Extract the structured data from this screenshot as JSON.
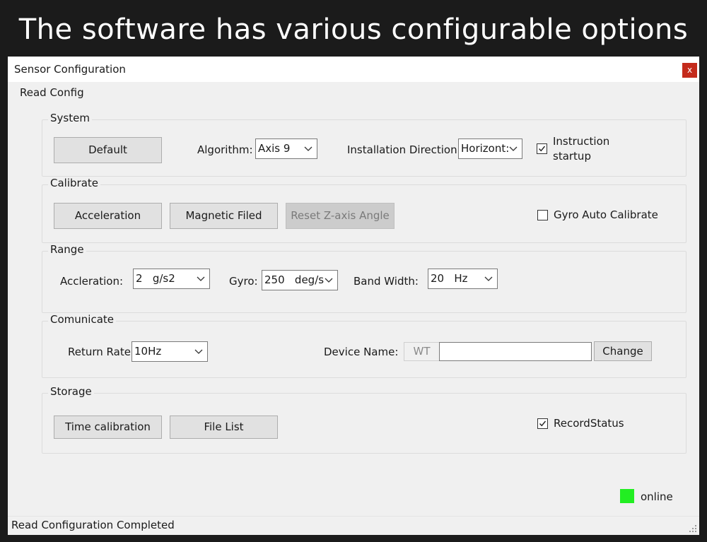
{
  "banner": {
    "caption": "The software has various configurable options"
  },
  "window": {
    "title": "Sensor Configuration",
    "close_label": "x"
  },
  "menu": {
    "read_config": "Read Config"
  },
  "system": {
    "legend": "System",
    "default_button": "Default",
    "algorithm_label": "Algorithm:",
    "algorithm_value": "Axis 9",
    "installation_label": "Installation Direction:",
    "installation_value": "Horizont:",
    "instruction_label_line1": "Instruction",
    "instruction_label_line2": "startup",
    "instruction_checked": true
  },
  "calibrate": {
    "legend": "Calibrate",
    "acceleration_button": "Acceleration",
    "magnetic_button": "Magnetic Filed",
    "reset_z_button": "Reset Z-axis Angle",
    "gyro_auto_label": "Gyro Auto Calibrate",
    "gyro_auto_checked": false
  },
  "range": {
    "legend": "Range",
    "accel_label": "Accleration:",
    "accel_value": "2   g/s2",
    "gyro_label": "Gyro:",
    "gyro_value": "250   deg/s",
    "bandwidth_label": "Band Width:",
    "bandwidth_value": "20   Hz"
  },
  "communicate": {
    "legend": "Comunicate",
    "return_rate_label": "Return Rate:",
    "return_rate_value": "10Hz",
    "device_name_label": "Device Name:",
    "device_prefix": "WT",
    "device_name_value": "",
    "change_button": "Change"
  },
  "storage": {
    "legend": "Storage",
    "time_calibration_button": "Time calibration",
    "file_list_button": "File List",
    "record_status_label": "RecordStatus",
    "record_status_checked": true
  },
  "connection": {
    "status_text": "online",
    "status_color": "#22ee22"
  },
  "status_bar": {
    "message": "Read Configuration Completed"
  }
}
